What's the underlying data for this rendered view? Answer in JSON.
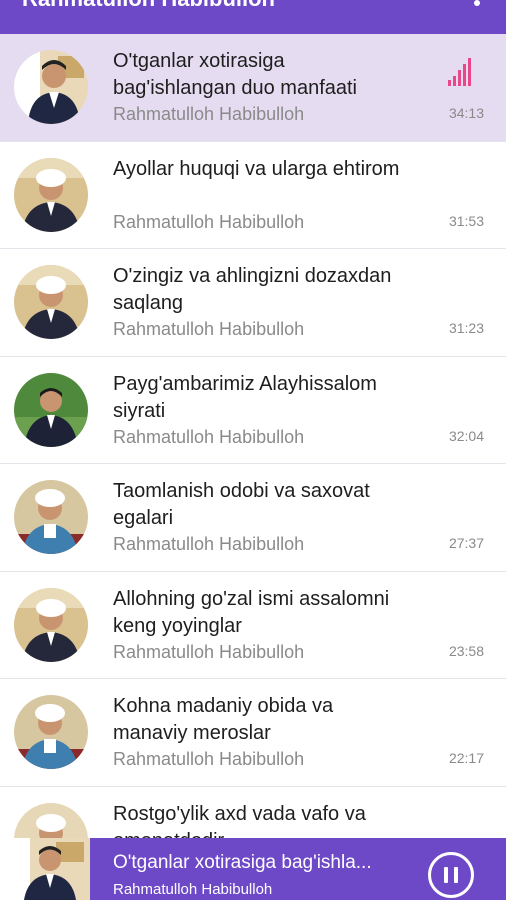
{
  "header": {
    "title": "Rahmatulloh Habibulloh",
    "menu_icon": "more-vert-icon"
  },
  "tracks": [
    {
      "title": "O'tganlar xotirasiga bag'ishlangan duo manfaati",
      "artist": "Rahmatulloh Habibulloh",
      "duration": "34:13",
      "playing": true
    },
    {
      "title": "Ayollar huquqi va ularga ehtirom",
      "artist": "Rahmatulloh Habibulloh",
      "duration": "31:53",
      "playing": false
    },
    {
      "title": "O'zingiz va ahlingizni dozaxdan saqlang",
      "artist": "Rahmatulloh Habibulloh",
      "duration": "31:23",
      "playing": false
    },
    {
      "title": "Payg'ambarimiz Alayhissalom siyrati",
      "artist": "Rahmatulloh Habibulloh",
      "duration": "32:04",
      "playing": false
    },
    {
      "title": "Taomlanish odobi va saxovat egalari",
      "artist": "Rahmatulloh Habibulloh",
      "duration": "27:37",
      "playing": false
    },
    {
      "title": "Allohning go'zal ismi assalomni keng yoyinglar",
      "artist": "Rahmatulloh Habibulloh",
      "duration": "23:58",
      "playing": false
    },
    {
      "title": "Kohna madaniy obida va manaviy meroslar",
      "artist": "Rahmatulloh Habibulloh",
      "duration": "22:17",
      "playing": false
    },
    {
      "title": "Rostgo'ylik axd vada vafo va omonatdodir",
      "artist": "",
      "duration": "",
      "playing": false
    }
  ],
  "player": {
    "title": "O'tganlar xotirasiga bag'ishla...",
    "artist": "Rahmatulloh Habibulloh",
    "pause_icon": "pause-icon"
  },
  "colors": {
    "accent": "#6d48c7",
    "active_row": "#e5dcf1",
    "equalizer": "#e8488a"
  }
}
